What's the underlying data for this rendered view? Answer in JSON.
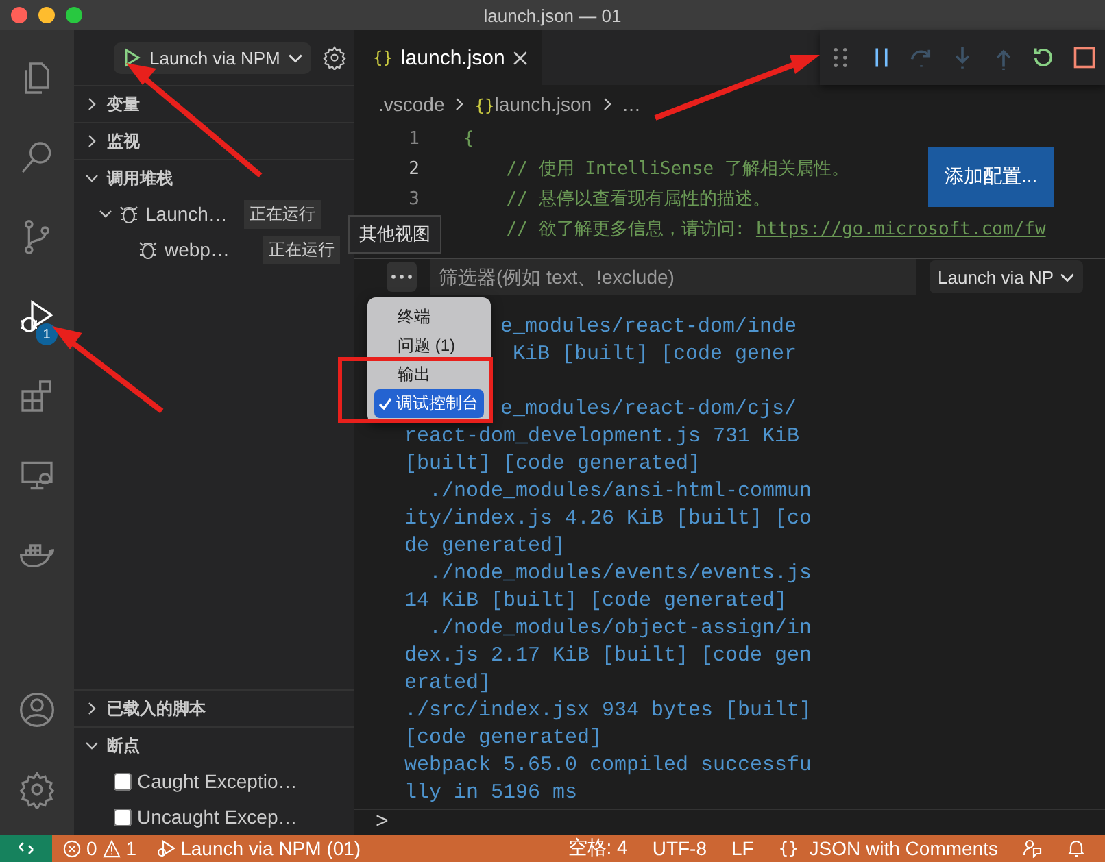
{
  "window": {
    "title": "launch.json — 01"
  },
  "activity_bar": {
    "items": [
      {
        "kind": "files",
        "selected": false
      },
      {
        "kind": "search",
        "selected": false
      },
      {
        "kind": "source-control",
        "selected": false
      },
      {
        "kind": "debug",
        "selected": true,
        "badge": "1"
      },
      {
        "kind": "extensions",
        "selected": false
      },
      {
        "kind": "remote",
        "selected": false
      },
      {
        "kind": "docker",
        "selected": false
      }
    ],
    "bottom": [
      {
        "kind": "account"
      },
      {
        "kind": "settings"
      }
    ]
  },
  "sidebar": {
    "config": "Launch via NPM",
    "sections": [
      {
        "title": "变量",
        "expanded": false
      },
      {
        "title": "监视",
        "expanded": false
      },
      {
        "title": "调用堆栈",
        "expanded": true,
        "items": [
          {
            "label": "Launch…",
            "status": "正在运行",
            "expanded": true,
            "children": [
              {
                "label": "webp…",
                "status": "正在运行"
              }
            ]
          }
        ]
      },
      {
        "title": "已载入的脚本",
        "expanded": false
      },
      {
        "title": "断点",
        "expanded": true,
        "breakpoints": [
          {
            "label": "Caught Exceptio…",
            "checked": false
          },
          {
            "label": "Uncaught Excep…",
            "checked": false
          }
        ]
      }
    ]
  },
  "editor": {
    "tabs": [
      {
        "icon": "{}",
        "label": "launch.json",
        "selected": true
      }
    ],
    "breadcrumb": [
      {
        "label": ".vscode"
      },
      {
        "icon": "{}",
        "label": "launch.json"
      },
      {
        "label": "…"
      }
    ],
    "lines": [
      {
        "number": "1",
        "text": "{"
      },
      {
        "number": "2",
        "text": "    // 使用 IntelliSense 了解相关属性。"
      },
      {
        "number": "3",
        "text": "    // 悬停以查看现有属性的描述。"
      },
      {
        "text": "    // 欲了解更多信息，请访问: ",
        "link": "https://go.microsoft.com/fw"
      }
    ],
    "add_config": "添加配置..."
  },
  "debug_toolbar": [
    {
      "kind": "grip",
      "disabled": false
    },
    {
      "kind": "pause",
      "disabled": false
    },
    {
      "kind": "step-over",
      "disabled": true
    },
    {
      "kind": "step-into",
      "disabled": true
    },
    {
      "kind": "step-out",
      "disabled": true
    },
    {
      "kind": "restart",
      "disabled": false
    },
    {
      "kind": "stop",
      "disabled": false
    }
  ],
  "panel": {
    "more_tooltip": "其他视图",
    "filter": {
      "placeholder": "筛选器(例如 text、!exclude)"
    },
    "session": "Launch via NP",
    "menu": [
      {
        "label": "终端",
        "selected": false
      },
      {
        "label": "问题 (1)",
        "selected": false
      },
      {
        "label": "输出",
        "selected": false
      },
      {
        "label": "调试控制台",
        "selected": true
      }
    ],
    "output": [
      {
        "kind": "clipped",
        "text": "e_modules/react-dom/inde"
      },
      {
        "kind": "clipped",
        "text": "KiB [built] [code gener"
      },
      {
        "kind": "covered"
      },
      {
        "kind": "clipped",
        "text": "e_modules/react-dom/cjs/"
      },
      {
        "kind": "line",
        "text": "react-dom_development.js 731 KiB"
      },
      {
        "kind": "line",
        "text": "[built] [code generated]"
      },
      {
        "kind": "line",
        "text": "  ./node_modules/ansi-html-commun"
      },
      {
        "kind": "line",
        "text": "ity/index.js 4.26 KiB [built] [co"
      },
      {
        "kind": "line",
        "text": "de generated]"
      },
      {
        "kind": "line",
        "text": "  ./node_modules/events/events.js"
      },
      {
        "kind": "line",
        "text": "14 KiB [built] [code generated]"
      },
      {
        "kind": "line",
        "text": "  ./node_modules/object-assign/in"
      },
      {
        "kind": "line",
        "text": "dex.js 2.17 KiB [built] [code gen"
      },
      {
        "kind": "line",
        "text": "erated]"
      },
      {
        "kind": "line",
        "text": "./src/index.jsx 934 bytes [built]"
      },
      {
        "kind": "line",
        "text": "[code generated]"
      },
      {
        "kind": "line",
        "text": "webpack 5.65.0 compiled successfu"
      },
      {
        "kind": "line",
        "text": "lly in 5196 ms"
      }
    ],
    "prompt": ">"
  },
  "status_bar": {
    "errors": "0",
    "warnings": "1",
    "debug": "Launch via NPM (01)",
    "right": [
      {
        "label": "空格: 4"
      },
      {
        "label": "UTF-8"
      },
      {
        "label": "LF"
      },
      {
        "icon": "{}",
        "label": "JSON with Comments"
      }
    ]
  }
}
